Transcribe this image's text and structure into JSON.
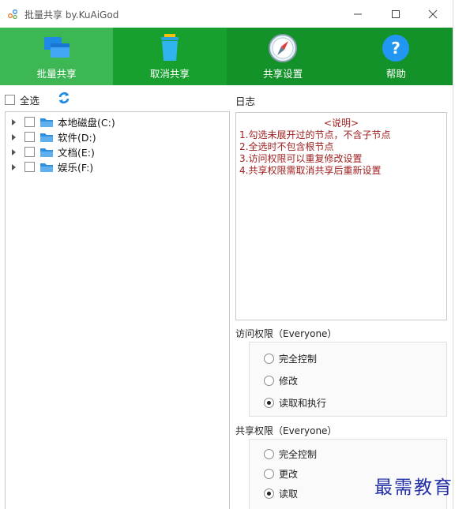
{
  "window": {
    "title": "批量共享 by.KuAiGod",
    "icon": "app-dots-icon",
    "controls": [
      "minimize-icon",
      "maximize-icon",
      "close-icon"
    ]
  },
  "toolbar": {
    "buttons": [
      {
        "label": "批量共享",
        "icon": "windows-share-icon"
      },
      {
        "label": "取消共享",
        "icon": "trash-bin-icon"
      },
      {
        "label": "共享设置",
        "icon": "compass-icon"
      },
      {
        "label": "帮助",
        "icon": "help-icon"
      }
    ],
    "active_index": 0
  },
  "left": {
    "select_all_label": "全选",
    "refresh_icon": "refresh-icon",
    "drives": [
      {
        "label": "本地磁盘(C:)"
      },
      {
        "label": "软件(D:)"
      },
      {
        "label": "文档(E:)"
      },
      {
        "label": "娱乐(F:)"
      }
    ]
  },
  "log": {
    "title": "日志",
    "heading": "<说明>",
    "lines": [
      "1.勾选未展开过的节点，不含子节点",
      "2.全选时不包含根节点",
      "3.访问权限可以重复修改设置",
      "4.共享权限需取消共享后重新设置"
    ]
  },
  "access": {
    "title": "访问权限（Everyone）",
    "options": [
      "完全控制",
      "修改",
      "读取和执行"
    ],
    "selected_index": 2
  },
  "share": {
    "title": "共享权限（Everyone）",
    "options": [
      "完全控制",
      "更改",
      "读取"
    ],
    "selected_index": 2
  },
  "watermark": "最需教育",
  "colors": {
    "toolbar_bg": "#18a02e",
    "toolbar_active": "#3cb753",
    "log_text": "#a02020",
    "watermark": "#2330a8"
  }
}
